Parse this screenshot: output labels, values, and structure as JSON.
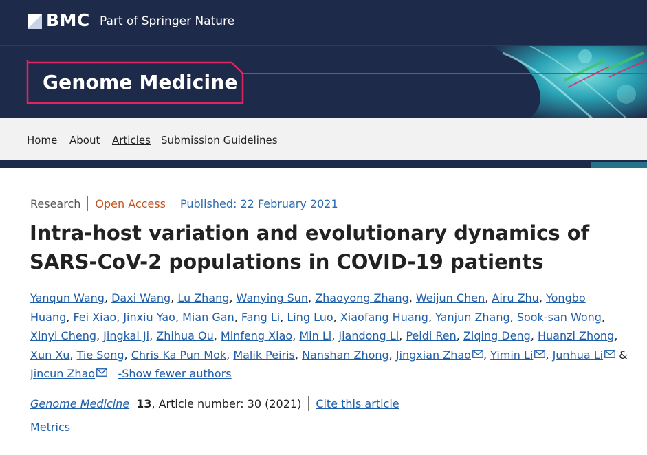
{
  "header": {
    "brand": "BMC",
    "tagline": "Part of Springer Nature"
  },
  "journal": {
    "title": "Genome Medicine"
  },
  "nav": {
    "items": [
      {
        "label": "Home"
      },
      {
        "label": "About"
      },
      {
        "label": "Articles",
        "active": true
      },
      {
        "label": "Submission Guidelines"
      }
    ]
  },
  "article": {
    "type": "Research",
    "access": "Open Access",
    "published": "Published: 22 February 2021",
    "title": "Intra-host variation and evolutionary dynamics of SARS-CoV-2 populations in COVID-19 patients",
    "authors": [
      {
        "name": "Yanqun Wang"
      },
      {
        "name": "Daxi Wang"
      },
      {
        "name": "Lu Zhang"
      },
      {
        "name": "Wanying Sun"
      },
      {
        "name": "Zhaoyong Zhang"
      },
      {
        "name": "Weijun Chen"
      },
      {
        "name": "Airu Zhu"
      },
      {
        "name": "Yongbo Huang"
      },
      {
        "name": "Fei Xiao"
      },
      {
        "name": "Jinxiu Yao"
      },
      {
        "name": "Mian Gan"
      },
      {
        "name": "Fang Li"
      },
      {
        "name": "Ling Luo"
      },
      {
        "name": "Xiaofang Huang"
      },
      {
        "name": "Yanjun Zhang"
      },
      {
        "name": "Sook-san Wong"
      },
      {
        "name": "Xinyi Cheng"
      },
      {
        "name": "Jingkai Ji"
      },
      {
        "name": "Zhihua Ou"
      },
      {
        "name": "Minfeng Xiao"
      },
      {
        "name": "Min Li"
      },
      {
        "name": "Jiandong Li"
      },
      {
        "name": "Peidi Ren"
      },
      {
        "name": "Ziqing Deng"
      },
      {
        "name": "Huanzi Zhong"
      },
      {
        "name": "Xun Xu"
      },
      {
        "name": "Tie Song"
      },
      {
        "name": "Chris Ka Pun Mok"
      },
      {
        "name": "Malik Peiris"
      },
      {
        "name": "Nanshan Zhong"
      },
      {
        "name": "Jingxian Zhao",
        "email": true
      },
      {
        "name": "Yimin Li",
        "email": true
      },
      {
        "name": "Junhua Li",
        "email": true
      },
      {
        "name": "Jincun Zhao",
        "email": true
      }
    ],
    "and_word": "&",
    "toggle_authors": "-Show fewer authors",
    "citation": {
      "journal": "Genome Medicine",
      "volume": "13",
      "details": ", Article number: 30 (2021)",
      "cite_label": "Cite this article"
    },
    "metrics_label": "Metrics"
  },
  "colors": {
    "header_bg": "#1e2a4a",
    "accent_pink": "#e0245e",
    "link": "#1f5ea8",
    "open_access": "#c05521",
    "published": "#2b6cb0"
  }
}
